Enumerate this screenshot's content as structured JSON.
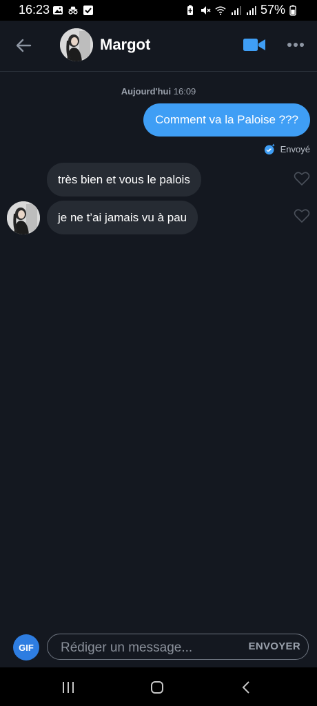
{
  "status_bar": {
    "time": "16:23",
    "battery": "57%",
    "icons": [
      "gallery-icon",
      "incognito-icon",
      "checkbox-icon",
      "battery-saver-icon",
      "mute-icon",
      "wifi-icon",
      "signal-icon",
      "signal-icon",
      "battery-icon"
    ]
  },
  "header": {
    "contact_name": "Margot",
    "back_icon": "arrow-left-icon",
    "video_icon": "video-camera-icon",
    "more_icon": "more-horizontal-icon",
    "accent_color": "#3f9ef5"
  },
  "conversation": {
    "date_prefix": "Aujourd'hui",
    "date_time": "16:09",
    "outgoing": [
      {
        "text": "Comment va la Paloise ???"
      }
    ],
    "sent_status": "Envoyé",
    "incoming": [
      {
        "text": "très bien et vous le palois"
      },
      {
        "text": "je ne t’ai jamais vu à pau"
      }
    ]
  },
  "composer": {
    "gif_label": "GIF",
    "placeholder": "Rédiger un message...",
    "send_label": "ENVOYER"
  },
  "nav": {
    "icons": [
      "recent-apps-icon",
      "home-icon",
      "back-icon"
    ]
  }
}
